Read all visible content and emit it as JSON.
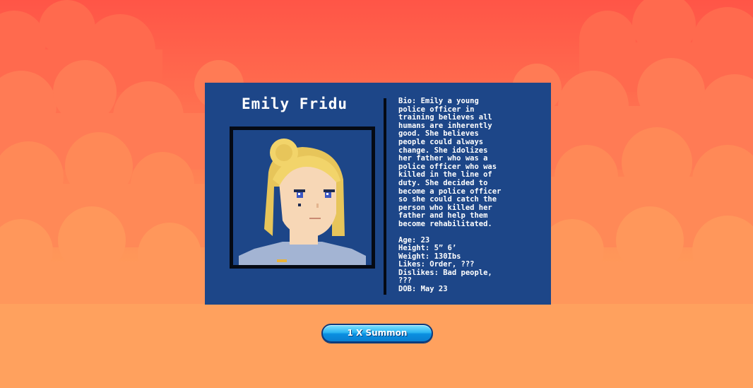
{
  "character": {
    "name": "Emily Fridu",
    "bio": "Bio: Emily a young\npolice officer in\ntraining believes all\nhumans are inherently\ngood. She believes\npeople could always\nchange. She idolizes\nher father who was a\npolice officer who was\nkilled in the line of\nduty. She decided to\nbecome a police officer\nso she could catch the\nperson who killed her\nfather and help them\nbecome rehabilitated.",
    "age": "Age: 23",
    "height": "Height: 5” 6’",
    "weight": "Weight: 130Ibs",
    "likes": "Likes: Order, ???",
    "dislikes": "Dislikes: Bad people,\n???",
    "dob": "DOB: May 23"
  },
  "summon_button": {
    "label": "1 X Summon"
  },
  "colors": {
    "card_background": "#1d4688",
    "sky_top": "#ff5a4a",
    "sky_bottom": "#ffa15c",
    "button": "#2eb6f2"
  }
}
